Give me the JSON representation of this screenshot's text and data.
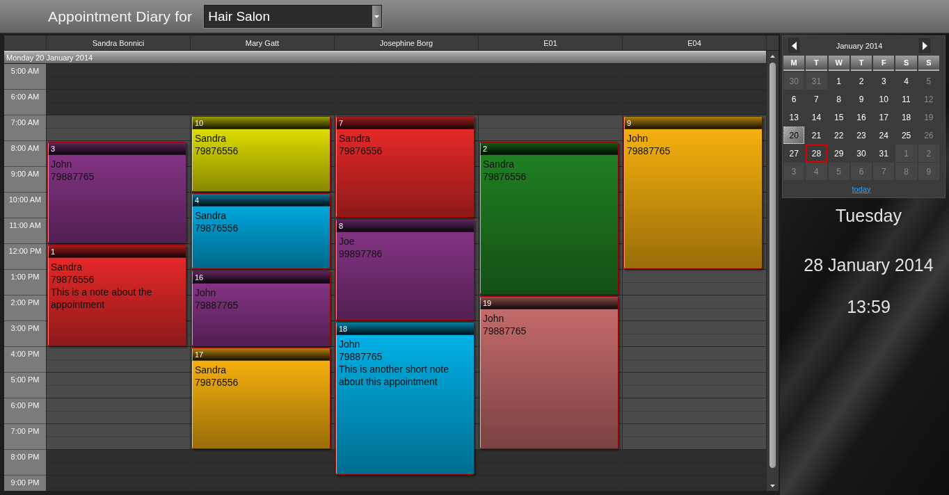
{
  "header": {
    "title": "Appointment Diary for",
    "location_select": {
      "value": "Hair Salon"
    }
  },
  "scheduler": {
    "resources": [
      {
        "name": "Sandra Bonnici",
        "slots": [
          {
            "kind": "free"
          },
          {
            "kind": "free"
          },
          {
            "kind": "free"
          },
          {
            "kind": "appointment",
            "number": "3",
            "client": "John",
            "phone": "79887765",
            "color": "#833383"
          },
          {
            "kind": "continued"
          },
          {
            "kind": "continued"
          },
          {
            "kind": "continued"
          },
          {
            "kind": "appointment",
            "number": "1",
            "client": "Sandra",
            "phone": "79876556",
            "note": "This is a note about the appointment",
            "color": "#e52828"
          },
          {
            "kind": "continued"
          },
          {
            "kind": "continued"
          },
          {
            "kind": "continued"
          },
          {
            "kind": "free"
          },
          {
            "kind": "free"
          },
          {
            "kind": "free"
          },
          {
            "kind": "free"
          },
          {
            "kind": "free"
          },
          {
            "kind": "free"
          }
        ]
      },
      {
        "name": "Mary Gatt",
        "slots": [
          {
            "kind": "free"
          },
          {
            "kind": "free"
          },
          {
            "kind": "appointment",
            "number": "10",
            "client": "Sandra",
            "phone": "79876556",
            "color": "#dcdc00"
          },
          {
            "kind": "continued"
          },
          {
            "kind": "continued"
          },
          {
            "kind": "appointment",
            "number": "4",
            "client": "Sandra",
            "phone": "79876556",
            "color": "#00a6dc"
          },
          {
            "kind": "continued"
          },
          {
            "kind": "continued"
          },
          {
            "kind": "appointment",
            "number": "16",
            "client": "John",
            "phone": "79887765",
            "color": "#833383"
          },
          {
            "kind": "continued"
          },
          {
            "kind": "continued"
          },
          {
            "kind": "appointment",
            "number": "17",
            "client": "Sandra",
            "phone": "79876556",
            "color": "#f5b00e"
          },
          {
            "kind": "continued"
          },
          {
            "kind": "continued"
          },
          {
            "kind": "continued"
          },
          {
            "kind": "free"
          },
          {
            "kind": "free"
          }
        ]
      },
      {
        "name": "Josephine Borg",
        "slots": [
          {
            "kind": "free"
          },
          {
            "kind": "free"
          },
          {
            "kind": "appointment",
            "number": "7",
            "client": "Sandra",
            "phone": "79876556",
            "color": "#e52828"
          },
          {
            "kind": "continued"
          },
          {
            "kind": "continued"
          },
          {
            "kind": "continued"
          },
          {
            "kind": "appointment",
            "number": "8",
            "client": "Joe",
            "phone": "99897786",
            "color": "#833383"
          },
          {
            "kind": "continued"
          },
          {
            "kind": "continued"
          },
          {
            "kind": "continued"
          },
          {
            "kind": "appointment",
            "number": "18",
            "client": "John",
            "phone": "79887765",
            "note": "This is another short note about this appointment",
            "color": "#00b0e6"
          },
          {
            "kind": "continued"
          },
          {
            "kind": "continued"
          },
          {
            "kind": "continued"
          },
          {
            "kind": "continued"
          },
          {
            "kind": "continued"
          },
          {
            "kind": "free"
          }
        ]
      },
      {
        "name": "E01",
        "slots": [
          {
            "kind": "free"
          },
          {
            "kind": "free"
          },
          {
            "kind": "free"
          },
          {
            "kind": "appointment",
            "number": "2",
            "client": "Sandra",
            "phone": "79876556",
            "color": "#1f8022"
          },
          {
            "kind": "continued"
          },
          {
            "kind": "continued"
          },
          {
            "kind": "continued"
          },
          {
            "kind": "continued"
          },
          {
            "kind": "continued"
          },
          {
            "kind": "appointment",
            "number": "19",
            "client": "John",
            "phone": "79887765",
            "color": "#c46a6a"
          },
          {
            "kind": "continued"
          },
          {
            "kind": "continued"
          },
          {
            "kind": "continued"
          },
          {
            "kind": "continued"
          },
          {
            "kind": "continued"
          },
          {
            "kind": "free"
          },
          {
            "kind": "free"
          }
        ]
      },
      {
        "name": "E04",
        "slots": [
          {
            "kind": "free"
          },
          {
            "kind": "free"
          },
          {
            "kind": "appointment",
            "number": "9",
            "client": "John",
            "phone": "79887765",
            "color": "#f5b00e"
          },
          {
            "kind": "continued"
          },
          {
            "kind": "continued"
          },
          {
            "kind": "continued"
          },
          {
            "kind": "continued"
          },
          {
            "kind": "continued"
          },
          {
            "kind": "free"
          },
          {
            "kind": "free"
          },
          {
            "kind": "free"
          },
          {
            "kind": "free"
          },
          {
            "kind": "free"
          },
          {
            "kind": "free"
          },
          {
            "kind": "free"
          },
          {
            "kind": "free"
          },
          {
            "kind": "free"
          }
        ]
      }
    ],
    "day_label": "Monday 20 January 2014",
    "time_rows": [
      {
        "label": "5:00 AM",
        "business_hours": false
      },
      {
        "label": "6:00 AM",
        "business_hours": false
      },
      {
        "label": "7:00 AM",
        "business_hours": true
      },
      {
        "label": "8:00 AM",
        "business_hours": true
      },
      {
        "label": "9:00 AM",
        "business_hours": true
      },
      {
        "label": "10:00 AM",
        "business_hours": true
      },
      {
        "label": "11:00 AM",
        "business_hours": true
      },
      {
        "label": "12:00 PM",
        "business_hours": true
      },
      {
        "label": "1:00 PM",
        "business_hours": true
      },
      {
        "label": "2:00 PM",
        "business_hours": true
      },
      {
        "label": "3:00 PM",
        "business_hours": true
      },
      {
        "label": "4:00 PM",
        "business_hours": true
      },
      {
        "label": "5:00 PM",
        "business_hours": true
      },
      {
        "label": "6:00 PM",
        "business_hours": true
      },
      {
        "label": "7:00 PM",
        "business_hours": true
      },
      {
        "label": "8:00 PM",
        "business_hours": false
      },
      {
        "label": "9:00 PM",
        "business_hours": false
      }
    ]
  },
  "mini_calendar": {
    "month_label": "January 2014",
    "weekdays": [
      "M",
      "T",
      "W",
      "T",
      "F",
      "S",
      "S"
    ],
    "days": [
      {
        "label": "30",
        "kind": "adjacent",
        "selected": false,
        "today": false
      },
      {
        "label": "31",
        "kind": "adjacent",
        "selected": false,
        "today": false
      },
      {
        "label": "1",
        "kind": "current",
        "selected": false,
        "today": false
      },
      {
        "label": "2",
        "kind": "current",
        "selected": false,
        "today": false
      },
      {
        "label": "3",
        "kind": "current",
        "selected": false,
        "today": false
      },
      {
        "label": "4",
        "kind": "current",
        "selected": false,
        "today": false
      },
      {
        "label": "5",
        "kind": "weekend",
        "selected": false,
        "today": false
      },
      {
        "label": "6",
        "kind": "current",
        "selected": false,
        "today": false
      },
      {
        "label": "7",
        "kind": "current",
        "selected": false,
        "today": false
      },
      {
        "label": "8",
        "kind": "current",
        "selected": false,
        "today": false
      },
      {
        "label": "9",
        "kind": "current",
        "selected": false,
        "today": false
      },
      {
        "label": "10",
        "kind": "current",
        "selected": false,
        "today": false
      },
      {
        "label": "11",
        "kind": "current",
        "selected": false,
        "today": false
      },
      {
        "label": "12",
        "kind": "weekend",
        "selected": false,
        "today": false
      },
      {
        "label": "13",
        "kind": "current",
        "selected": false,
        "today": false
      },
      {
        "label": "14",
        "kind": "current",
        "selected": false,
        "today": false
      },
      {
        "label": "15",
        "kind": "current",
        "selected": false,
        "today": false
      },
      {
        "label": "16",
        "kind": "current",
        "selected": false,
        "today": false
      },
      {
        "label": "17",
        "kind": "current",
        "selected": false,
        "today": false
      },
      {
        "label": "18",
        "kind": "current",
        "selected": false,
        "today": false
      },
      {
        "label": "19",
        "kind": "weekend",
        "selected": false,
        "today": false
      },
      {
        "label": "20",
        "kind": "current",
        "selected": true,
        "today": false
      },
      {
        "label": "21",
        "kind": "current",
        "selected": false,
        "today": false
      },
      {
        "label": "22",
        "kind": "current",
        "selected": false,
        "today": false
      },
      {
        "label": "23",
        "kind": "current",
        "selected": false,
        "today": false
      },
      {
        "label": "24",
        "kind": "current",
        "selected": false,
        "today": false
      },
      {
        "label": "25",
        "kind": "current",
        "selected": false,
        "today": false
      },
      {
        "label": "26",
        "kind": "weekend",
        "selected": false,
        "today": false
      },
      {
        "label": "27",
        "kind": "current",
        "selected": false,
        "today": false
      },
      {
        "label": "28",
        "kind": "current",
        "selected": false,
        "today": true
      },
      {
        "label": "29",
        "kind": "current",
        "selected": false,
        "today": false
      },
      {
        "label": "30",
        "kind": "current",
        "selected": false,
        "today": false
      },
      {
        "label": "31",
        "kind": "current",
        "selected": false,
        "today": false
      },
      {
        "label": "1",
        "kind": "adjacent",
        "selected": false,
        "today": false
      },
      {
        "label": "2",
        "kind": "adjacent",
        "selected": false,
        "today": false
      },
      {
        "label": "3",
        "kind": "adjacent",
        "selected": false,
        "today": false
      },
      {
        "label": "4",
        "kind": "adjacent",
        "selected": false,
        "today": false
      },
      {
        "label": "5",
        "kind": "adjacent",
        "selected": false,
        "today": false
      },
      {
        "label": "6",
        "kind": "adjacent",
        "selected": false,
        "today": false
      },
      {
        "label": "7",
        "kind": "adjacent",
        "selected": false,
        "today": false
      },
      {
        "label": "8",
        "kind": "adjacent",
        "selected": false,
        "today": false
      },
      {
        "label": "9",
        "kind": "adjacent",
        "selected": false,
        "today": false
      }
    ],
    "today_link": "today"
  },
  "today_display": {
    "weekday": "Tuesday",
    "date": "28 January 2014",
    "time": "13:59"
  }
}
